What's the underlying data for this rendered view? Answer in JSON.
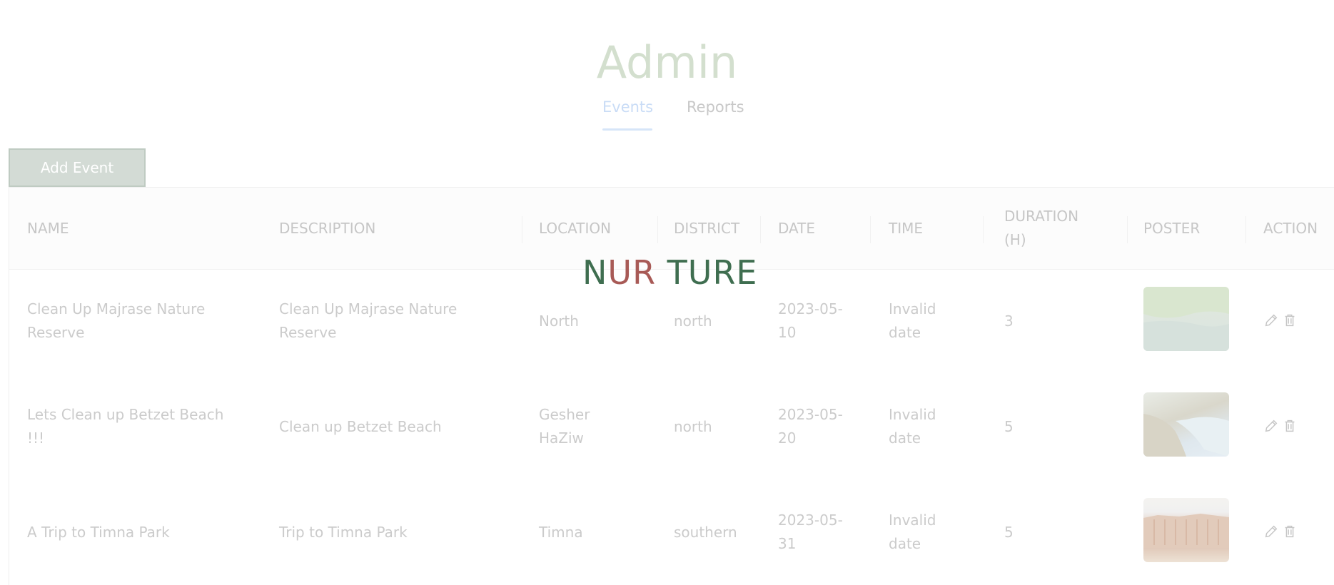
{
  "header": {
    "title": "Admin"
  },
  "tabs": {
    "events": "Events",
    "reports": "Reports"
  },
  "toolbar": {
    "add_event": "Add Event"
  },
  "logo": {
    "p1": "N",
    "p2": "UR",
    "p3": " TURE"
  },
  "table": {
    "columns": {
      "name": "NAME",
      "description": "DESCRIPTION",
      "location": "LOCATION",
      "district": "DISTRICT",
      "date": "DATE",
      "time": "TIME",
      "duration_l1": "DURATION",
      "duration_l2": "(H)",
      "poster": "POSTER",
      "action": "ACTION"
    },
    "rows": [
      {
        "name_l1": "Clean Up Majrase Nature",
        "name_l2": "Reserve",
        "desc_l1": "Clean Up Majrase Nature",
        "desc_l2": "Reserve",
        "loc_l1": "North",
        "loc_l2": "",
        "district": "north",
        "date_l1": "2023-05-",
        "date_l2": "10",
        "time_l1": "Invalid",
        "time_l2": "date",
        "duration": "3",
        "poster_icon": "nature-reserve-photo"
      },
      {
        "name_l1": "Lets Clean up Betzet Beach",
        "name_l2": "!!!",
        "desc_l1": "Clean up Betzet Beach",
        "desc_l2": "",
        "loc_l1": "Gesher",
        "loc_l2": "HaZiw",
        "district": "north",
        "date_l1": "2023-05-",
        "date_l2": "20",
        "time_l1": "Invalid",
        "time_l2": "date",
        "duration": "5",
        "poster_icon": "beach-coast-photo"
      },
      {
        "name_l1": "A Trip to Timna Park",
        "name_l2": "",
        "desc_l1": "Trip to Timna Park",
        "desc_l2": "",
        "loc_l1": "Timna",
        "loc_l2": "",
        "district": "southern",
        "date_l1": "2023-05-",
        "date_l2": "31",
        "time_l1": "Invalid",
        "time_l2": "date",
        "duration": "5",
        "poster_icon": "desert-cliffs-photo"
      }
    ],
    "action_icons": [
      "pencil-icon",
      "trash-icon"
    ]
  },
  "colors": {
    "title": "#d3dfce",
    "tab_active": "#c9dcf6",
    "button_bg": "#d3dbd5",
    "logo_green": "#3f6e50",
    "logo_red": "#a85a56"
  }
}
